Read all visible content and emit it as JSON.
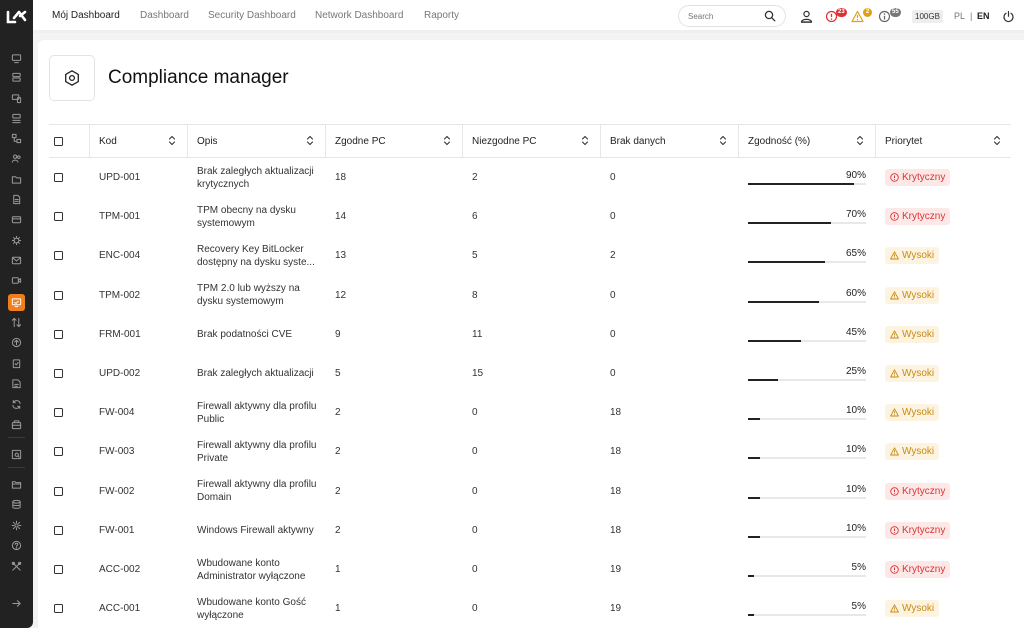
{
  "nav": {
    "items": [
      "Mój Dashboard",
      "Dashboard",
      "Security Dashboard",
      "Network Dashboard",
      "Raporty"
    ]
  },
  "search": {
    "placeholder": "Search"
  },
  "alerts": {
    "errors": "23",
    "warnings": "2",
    "info": "55"
  },
  "storage": "100GB",
  "lang": {
    "pl": "PL",
    "sep": "|",
    "en": "EN"
  },
  "page": {
    "title": "Compliance manager"
  },
  "table": {
    "headers": {
      "kod": "Kod",
      "opis": "Opis",
      "zgodne": "Zgodne PC",
      "niezgodne": "Niezgodne PC",
      "brak": "Brak danych",
      "zgodnosc": "Zgodność (%)",
      "priorytet": "Priorytet"
    },
    "rows": [
      {
        "kod": "UPD-001",
        "opis": "Brak zaległych aktualizacji krytycznych",
        "zgodne": "18",
        "niezgodne": "2",
        "brak": "0",
        "pct": 90,
        "pct_label": "90%",
        "prio": "Krytyczny",
        "level": "krit"
      },
      {
        "kod": "TPM-001",
        "opis": "TPM obecny na dysku systemowym",
        "zgodne": "14",
        "niezgodne": "6",
        "brak": "0",
        "pct": 70,
        "pct_label": "70%",
        "prio": "Krytyczny",
        "level": "krit"
      },
      {
        "kod": "ENC-004",
        "opis": "Recovery Key BitLocker dostępny na dysku syste...",
        "zgodne": "13",
        "niezgodne": "5",
        "brak": "2",
        "pct": 65,
        "pct_label": "65%",
        "prio": "Wysoki",
        "level": "wys"
      },
      {
        "kod": "TPM-002",
        "opis": "TPM 2.0 lub wyższy na dysku systemowym",
        "zgodne": "12",
        "niezgodne": "8",
        "brak": "0",
        "pct": 60,
        "pct_label": "60%",
        "prio": "Wysoki",
        "level": "wys"
      },
      {
        "kod": "FRM-001",
        "opis": "Brak podatności CVE",
        "zgodne": "9",
        "niezgodne": "11",
        "brak": "0",
        "pct": 45,
        "pct_label": "45%",
        "prio": "Wysoki",
        "level": "wys"
      },
      {
        "kod": "UPD-002",
        "opis": "Brak zaległych aktualizacji",
        "zgodne": "5",
        "niezgodne": "15",
        "brak": "0",
        "pct": 25,
        "pct_label": "25%",
        "prio": "Wysoki",
        "level": "wys"
      },
      {
        "kod": "FW-004",
        "opis": "Firewall aktywny dla profilu Public",
        "zgodne": "2",
        "niezgodne": "0",
        "brak": "18",
        "pct": 10,
        "pct_label": "10%",
        "prio": "Wysoki",
        "level": "wys"
      },
      {
        "kod": "FW-003",
        "opis": "Firewall aktywny dla profilu Private",
        "zgodne": "2",
        "niezgodne": "0",
        "brak": "18",
        "pct": 10,
        "pct_label": "10%",
        "prio": "Wysoki",
        "level": "wys"
      },
      {
        "kod": "FW-002",
        "opis": "Firewall aktywny dla profilu Domain",
        "zgodne": "2",
        "niezgodne": "0",
        "brak": "18",
        "pct": 10,
        "pct_label": "10%",
        "prio": "Krytyczny",
        "level": "krit"
      },
      {
        "kod": "FW-001",
        "opis": "Windows Firewall aktywny",
        "zgodne": "2",
        "niezgodne": "0",
        "brak": "18",
        "pct": 10,
        "pct_label": "10%",
        "prio": "Krytyczny",
        "level": "krit"
      },
      {
        "kod": "ACC-002",
        "opis": "Wbudowane konto Administrator wyłączone",
        "zgodne": "1",
        "niezgodne": "0",
        "brak": "19",
        "pct": 5,
        "pct_label": "5%",
        "prio": "Krytyczny",
        "level": "krit"
      },
      {
        "kod": "ACC-001",
        "opis": "Wbudowane konto Gość wyłączone",
        "zgodne": "1",
        "niezgodne": "0",
        "brak": "19",
        "pct": 5,
        "pct_label": "5%",
        "prio": "Wysoki",
        "level": "wys"
      }
    ]
  },
  "sidebar": {
    "icons": [
      "monitor-icon",
      "server-icon",
      "devices-icon",
      "storage-icon",
      "network-icon",
      "users-icon",
      "folder-icon",
      "document-icon",
      "card-icon",
      "bug-icon",
      "mail-icon",
      "video-icon",
      "compliance-icon",
      "transfer-icon",
      "upload-icon",
      "clipboard-icon",
      "report-icon",
      "sync-icon",
      "inventory-icon",
      "scan-icon",
      "files-icon",
      "database-icon",
      "settings-icon",
      "help-icon",
      "tools-icon",
      "expand-icon"
    ],
    "active": "compliance-icon"
  },
  "colors": {
    "accent": "#f07f1b",
    "critical": "#dd3333",
    "high": "#c98a12",
    "sidebar": "#222222"
  }
}
